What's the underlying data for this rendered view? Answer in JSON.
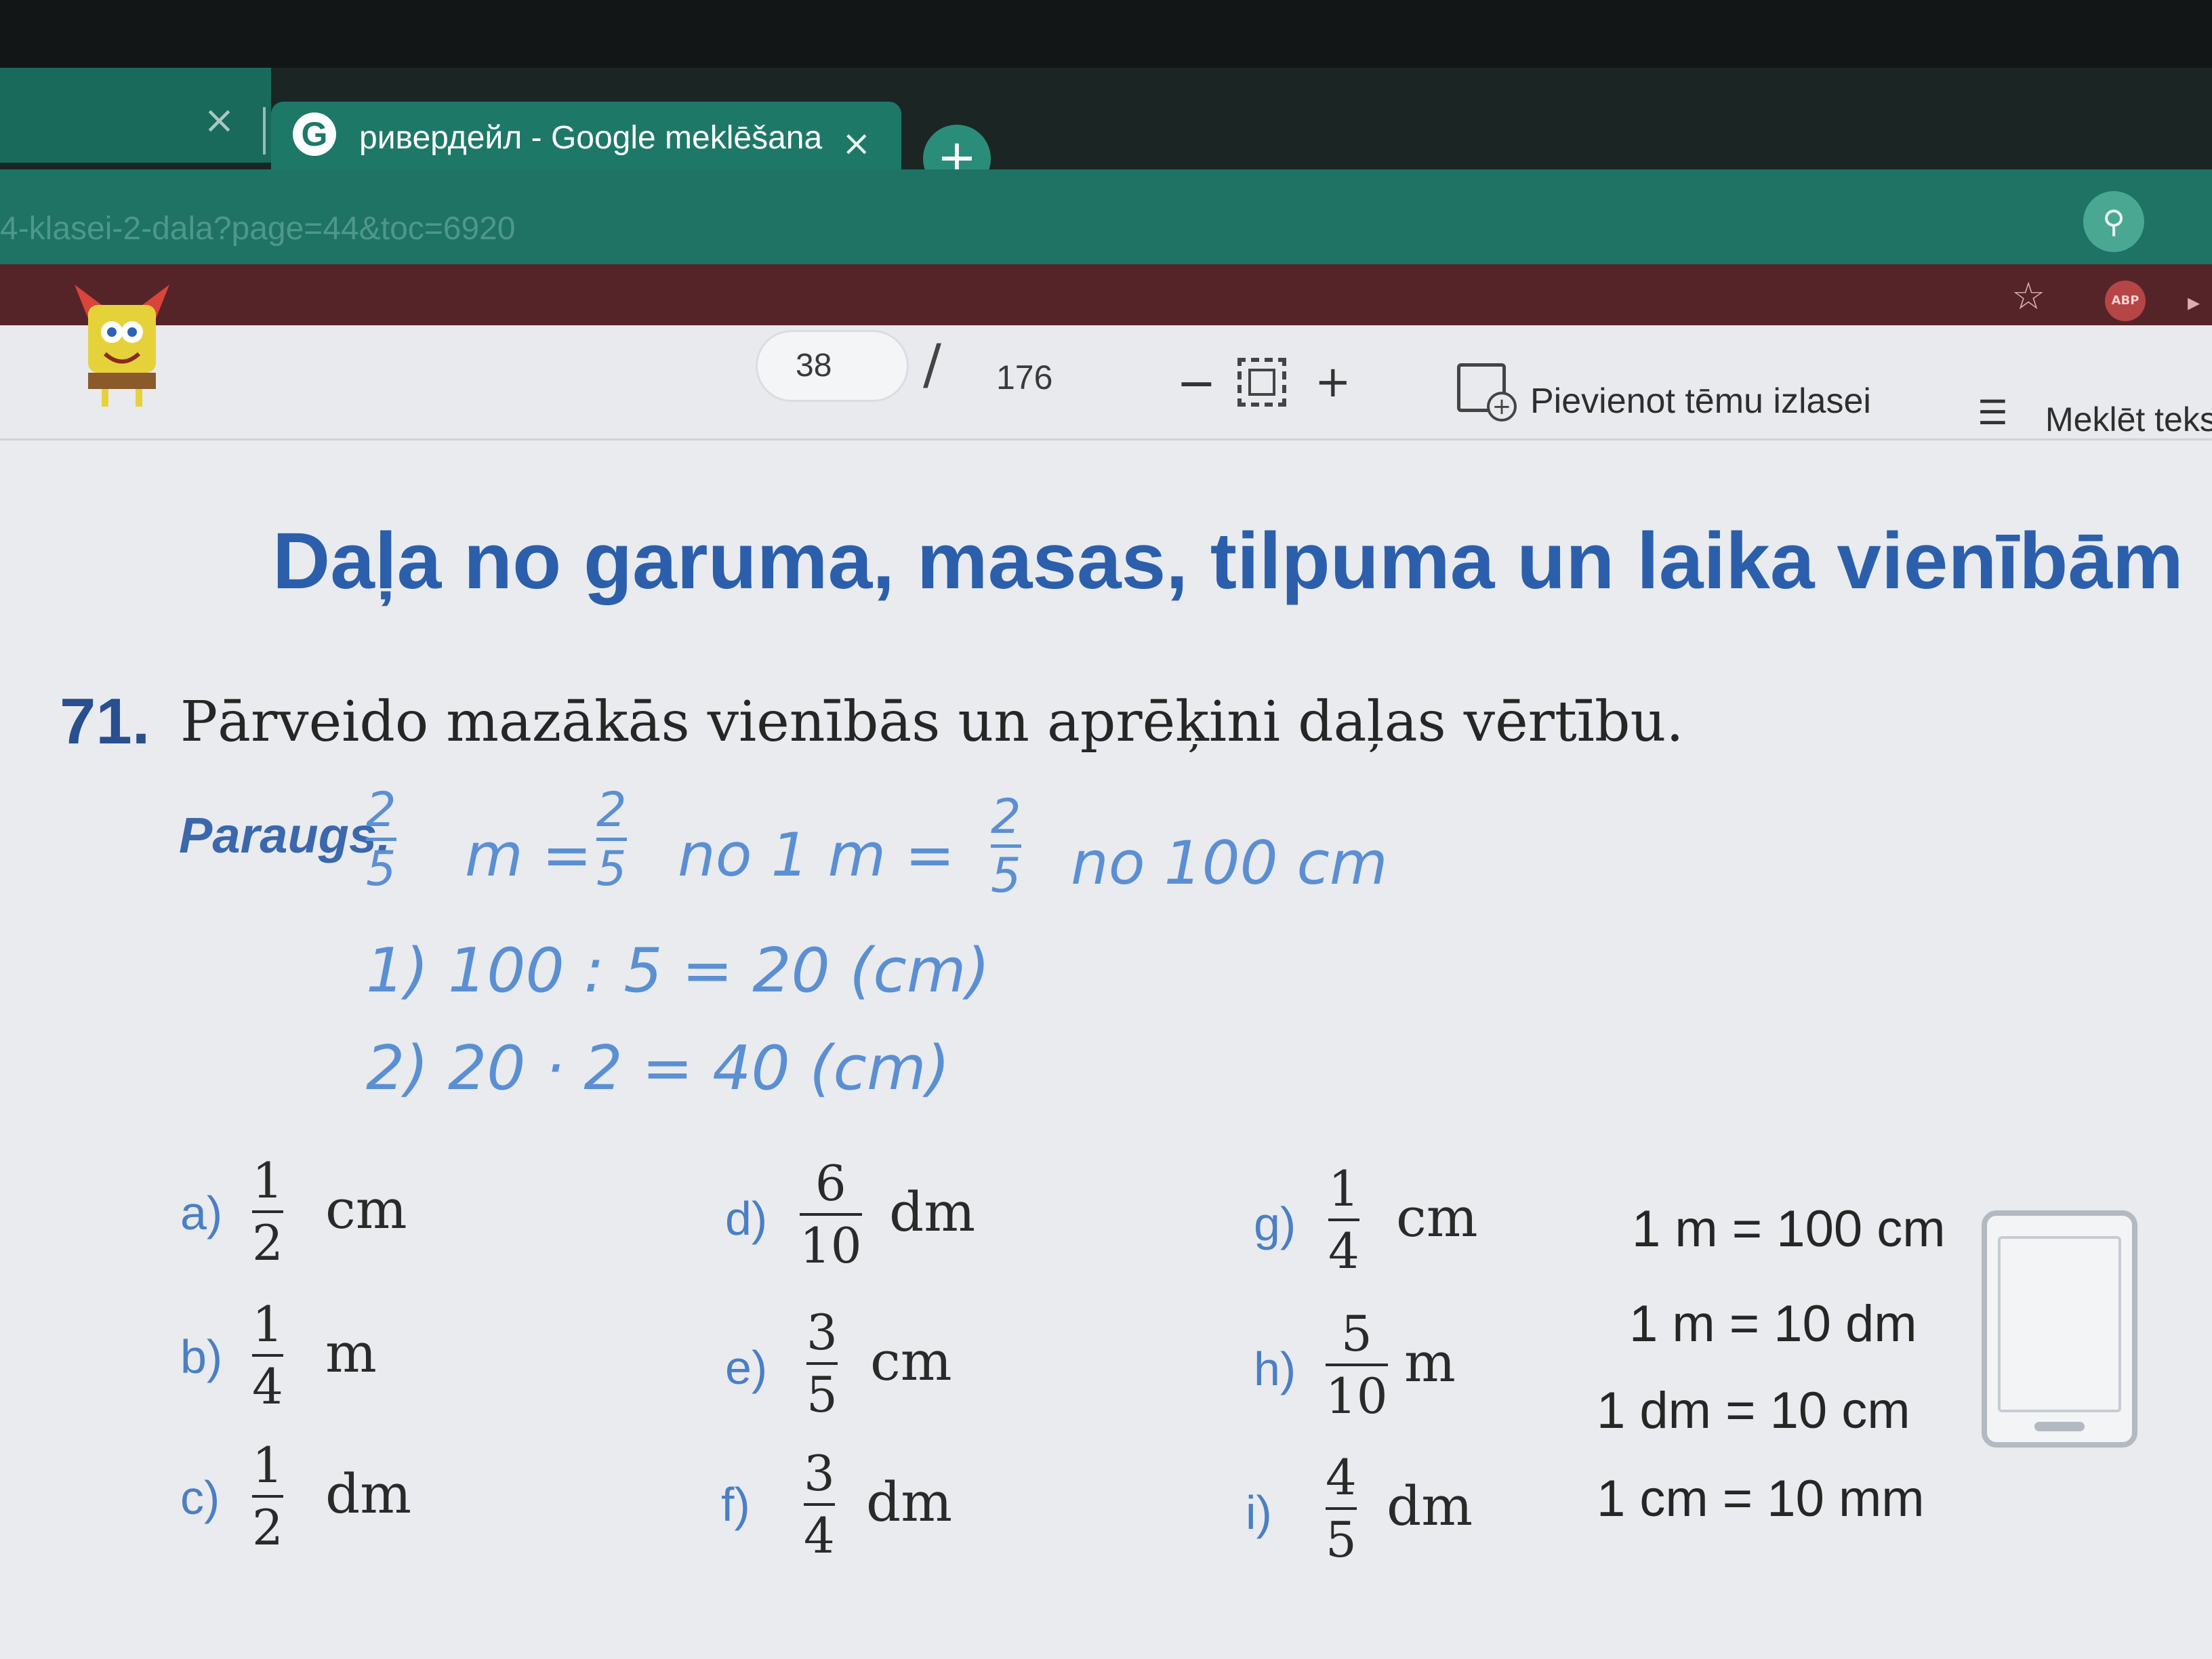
{
  "browser": {
    "tabs": [
      {
        "title": "",
        "active": false
      },
      {
        "title": "ривердейл - Google meklēšana",
        "active": true
      }
    ],
    "tab_close_glyph": "×",
    "new_tab_glyph": "+",
    "url": "4-klasei-2-dala?page=44&toc=6920",
    "icons": {
      "google": "G",
      "star": "☆",
      "abp": "ABP",
      "location": "⚲",
      "more": "▸"
    }
  },
  "viewer": {
    "current_page": "38",
    "separator": "/",
    "total_pages": "176",
    "zoom_out": "−",
    "zoom_in": "+",
    "add_topic_label": "Pievienot tēmu izlasei",
    "search_label": "Meklēt teks"
  },
  "content": {
    "title": "Daļa no garuma, masas, tilpuma un laika vienībām",
    "exercise": {
      "number": "71.",
      "instruction": "Pārveido mazākās vienībās un aprēķini daļas vērtību.",
      "example_label": "Paraugs.",
      "example": {
        "frac1": {
          "n": "2",
          "d": "5"
        },
        "t1": "m =",
        "frac2": {
          "n": "2",
          "d": "5"
        },
        "t2": "no 1 m =",
        "frac3": {
          "n": "2",
          "d": "5"
        },
        "t3": "no 100 cm",
        "step1": "1) 100 : 5 = 20 (cm)",
        "step2": "2) 20 · 2 = 40 (cm)"
      },
      "items": [
        {
          "letter": "a)",
          "n": "1",
          "d": "2",
          "unit": "cm"
        },
        {
          "letter": "b)",
          "n": "1",
          "d": "4",
          "unit": "m"
        },
        {
          "letter": "c)",
          "n": "1",
          "d": "2",
          "unit": "dm"
        },
        {
          "letter": "d)",
          "n": "6",
          "d": "10",
          "unit": "dm"
        },
        {
          "letter": "e)",
          "n": "3",
          "d": "5",
          "unit": "cm"
        },
        {
          "letter": "f)",
          "n": "3",
          "d": "4",
          "unit": "dm"
        },
        {
          "letter": "g)",
          "n": "1",
          "d": "4",
          "unit": "cm"
        },
        {
          "letter": "h)",
          "n": "5",
          "d": "10",
          "unit": "m"
        },
        {
          "letter": "i)",
          "n": "4",
          "d": "5",
          "unit": "dm"
        }
      ],
      "conversions": [
        "1 m = 100 cm",
        "1 m = 10 dm",
        "1 dm = 10 cm",
        "1 cm = 10 mm"
      ]
    }
  }
}
